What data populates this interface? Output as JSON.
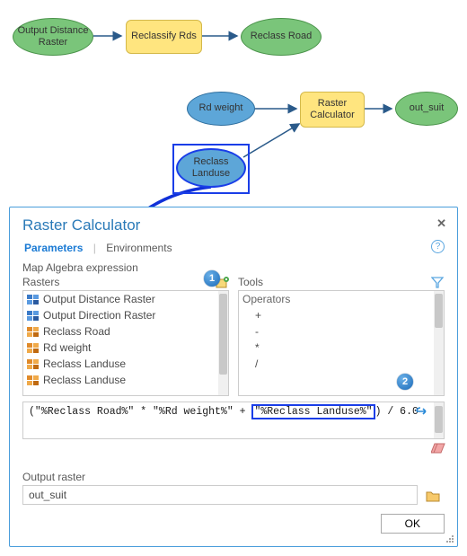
{
  "diagram": {
    "nodes": {
      "output_distance_raster": "Output Distance Raster",
      "reclassify_rds": "Reclassify Rds",
      "reclass_road": "Reclass Road",
      "rd_weight": "Rd weight",
      "raster_calculator": "Raster Calculator",
      "out_suit": "out_suit",
      "reclass_landuse": "Reclass Landuse"
    }
  },
  "dialog": {
    "title": "Raster Calculator",
    "tabs": {
      "parameters": "Parameters",
      "environments": "Environments"
    },
    "section_label": "Map Algebra expression",
    "rasters_label": "Rasters",
    "tools_label": "Tools",
    "operators_header": "Operators",
    "raster_items": [
      {
        "label": "Output Distance Raster",
        "color": "blue"
      },
      {
        "label": "Output Direction Raster",
        "color": "blue"
      },
      {
        "label": "Reclass Road",
        "color": "orange"
      },
      {
        "label": "Rd weight",
        "color": "orange"
      },
      {
        "label": "Reclass Landuse",
        "color": "orange"
      },
      {
        "label": "Reclass Landuse",
        "color": "orange"
      }
    ],
    "operators": [
      "+",
      "-",
      "*",
      "/"
    ],
    "expression": {
      "p1": "(\"%Reclass Road%\"  *  \"%Rd weight%\" + ",
      "hl": "\"%Reclass Landuse%\"",
      "p2": ") / 6.0"
    },
    "output_label": "Output raster",
    "output_value": "out_suit",
    "ok": "OK",
    "callouts": {
      "one": "1",
      "two": "2"
    }
  }
}
